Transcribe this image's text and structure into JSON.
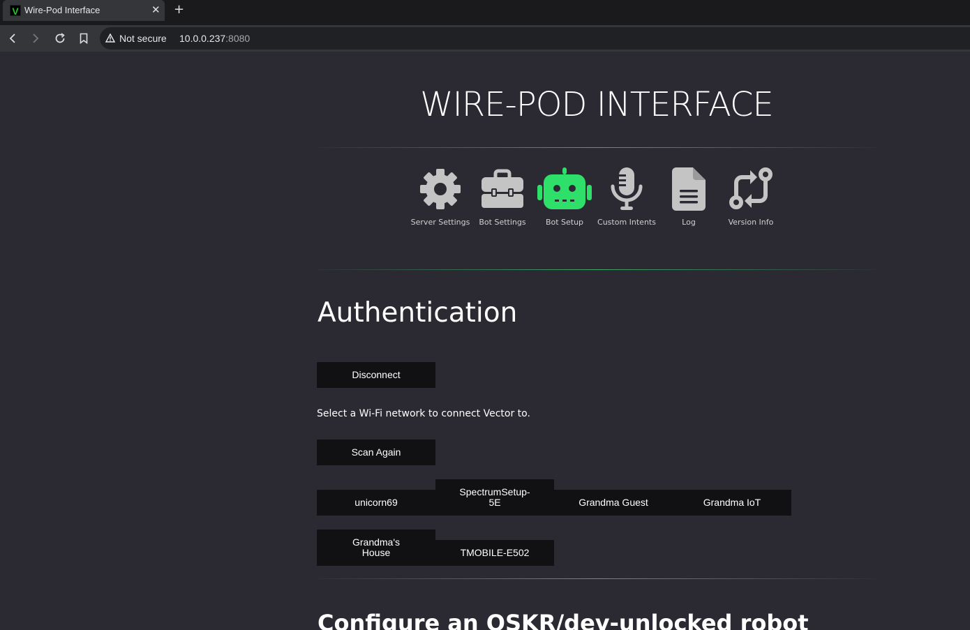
{
  "browser": {
    "tab_title": "Wire-Pod Interface",
    "favicon_letter": "V",
    "security_label": "Not secure",
    "url_host": "10.0.0.237",
    "url_port": ":8080"
  },
  "page": {
    "title": "WIRE-POD INTERFACE",
    "nav": [
      {
        "label": "Server Settings",
        "icon": "gear-icon",
        "active": false
      },
      {
        "label": "Bot Settings",
        "icon": "toolbox-icon",
        "active": false
      },
      {
        "label": "Bot Setup",
        "icon": "robot-icon",
        "active": true
      },
      {
        "label": "Custom Intents",
        "icon": "microphone-icon",
        "active": false
      },
      {
        "label": "Log",
        "icon": "document-icon",
        "active": false
      },
      {
        "label": "Version Info",
        "icon": "branch-sync-icon",
        "active": false
      }
    ],
    "auth": {
      "heading": "Authentication",
      "disconnect_label": "Disconnect",
      "instruction": "Select a Wi-Fi network to connect Vector to.",
      "scan_label": "Scan Again",
      "networks": [
        "unicorn69",
        "SpectrumSetup-5E",
        "Grandma Guest",
        "Grandma IoT",
        "Grandma's House",
        "TMOBILE-E502"
      ]
    },
    "next_section_heading": "Configure an OSKR/dev-unlocked robot"
  },
  "colors": {
    "background": "#2b2a33",
    "accent_green": "#2ee06a",
    "icon_gray": "#c4c4c4",
    "button_bg": "#111113"
  }
}
